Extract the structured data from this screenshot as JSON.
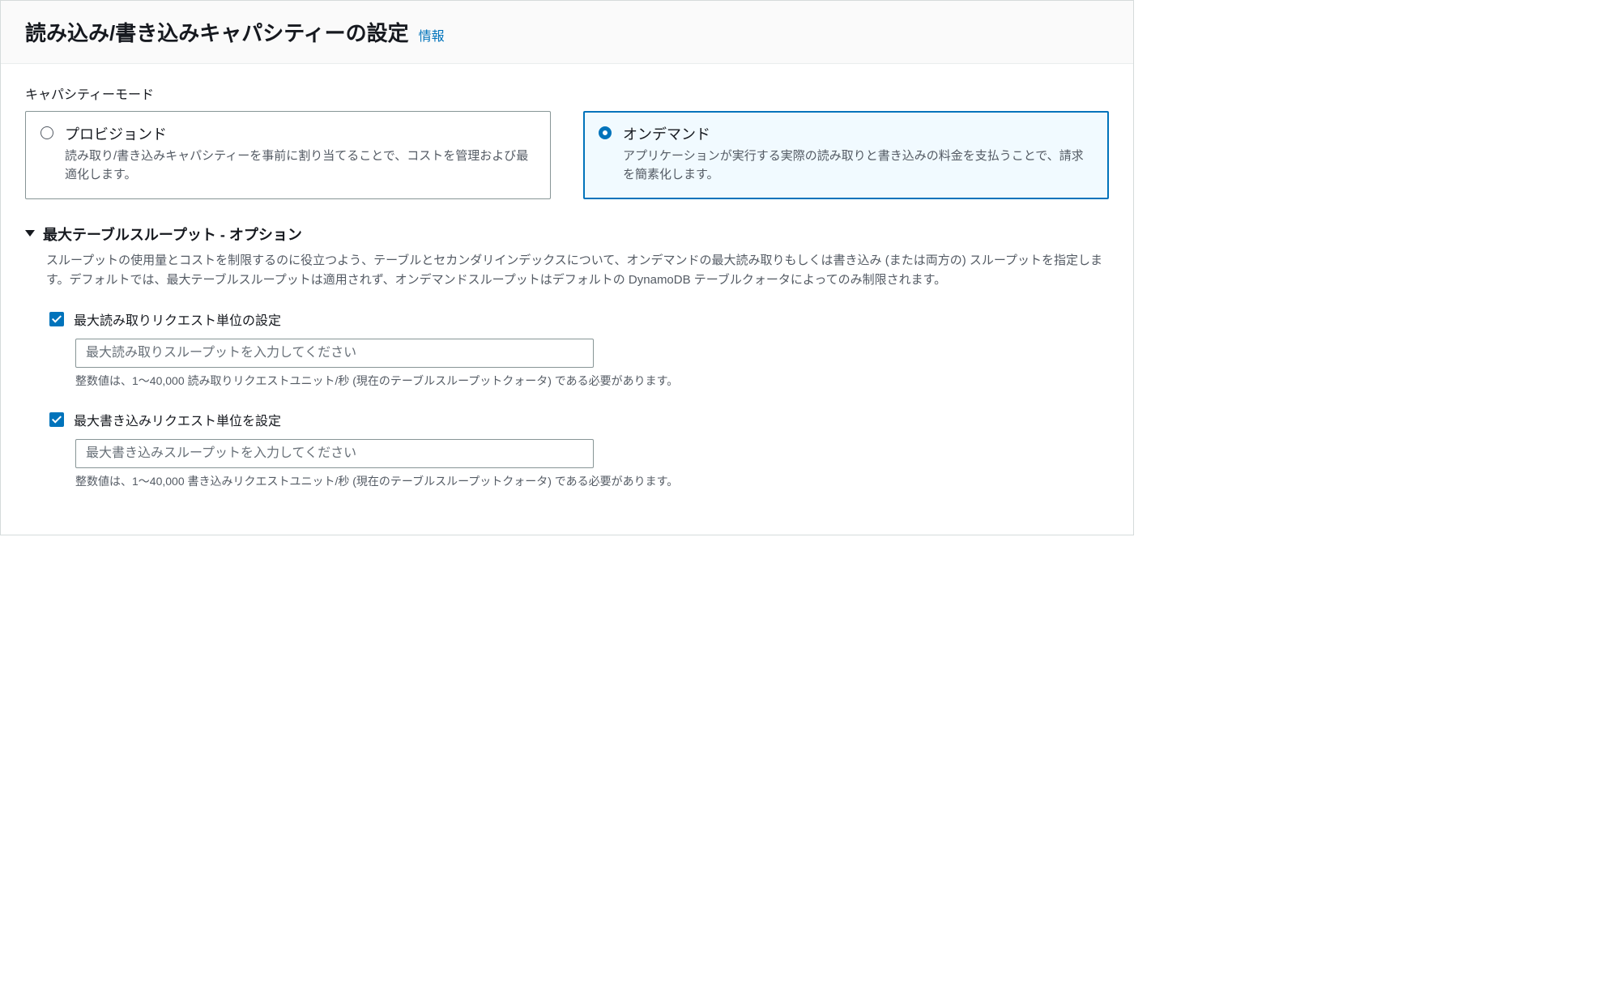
{
  "header": {
    "title": "読み込み/書き込みキャパシティーの設定",
    "info_link": "情報"
  },
  "capacity_mode": {
    "label": "キャパシティーモード",
    "options": [
      {
        "title": "プロビジョンド",
        "description": "読み取り/書き込みキャパシティーを事前に割り当てることで、コストを管理および最適化します。",
        "selected": false
      },
      {
        "title": "オンデマンド",
        "description": "アプリケーションが実行する実際の読み取りと書き込みの料金を支払うことで、請求を簡素化します。",
        "selected": true
      }
    ]
  },
  "throughput": {
    "title": "最大テーブルスループット - オプション",
    "description": "スループットの使用量とコストを制限するのに役立つよう、テーブルとセカンダリインデックスについて、オンデマンドの最大読み取りもしくは書き込み (または両方の) スループットを指定します。デフォルトでは、最大テーブルスループットは適用されず、オンデマンドスループットはデフォルトの DynamoDB テーブルクォータによってのみ制限されます。",
    "read": {
      "checkbox_label": "最大読み取りリクエスト単位の設定",
      "checked": true,
      "placeholder": "最大読み取りスループットを入力してください",
      "value": "",
      "helper": "整数値は、1～40,000 読み取りリクエストユニット/秒 (現在のテーブルスループットクォータ) である必要があります。"
    },
    "write": {
      "checkbox_label": "最大書き込みリクエスト単位を設定",
      "checked": true,
      "placeholder": "最大書き込みスループットを入力してください",
      "value": "",
      "helper": "整数値は、1～40,000 書き込みリクエストユニット/秒 (現在のテーブルスループットクォータ) である必要があります。"
    }
  }
}
